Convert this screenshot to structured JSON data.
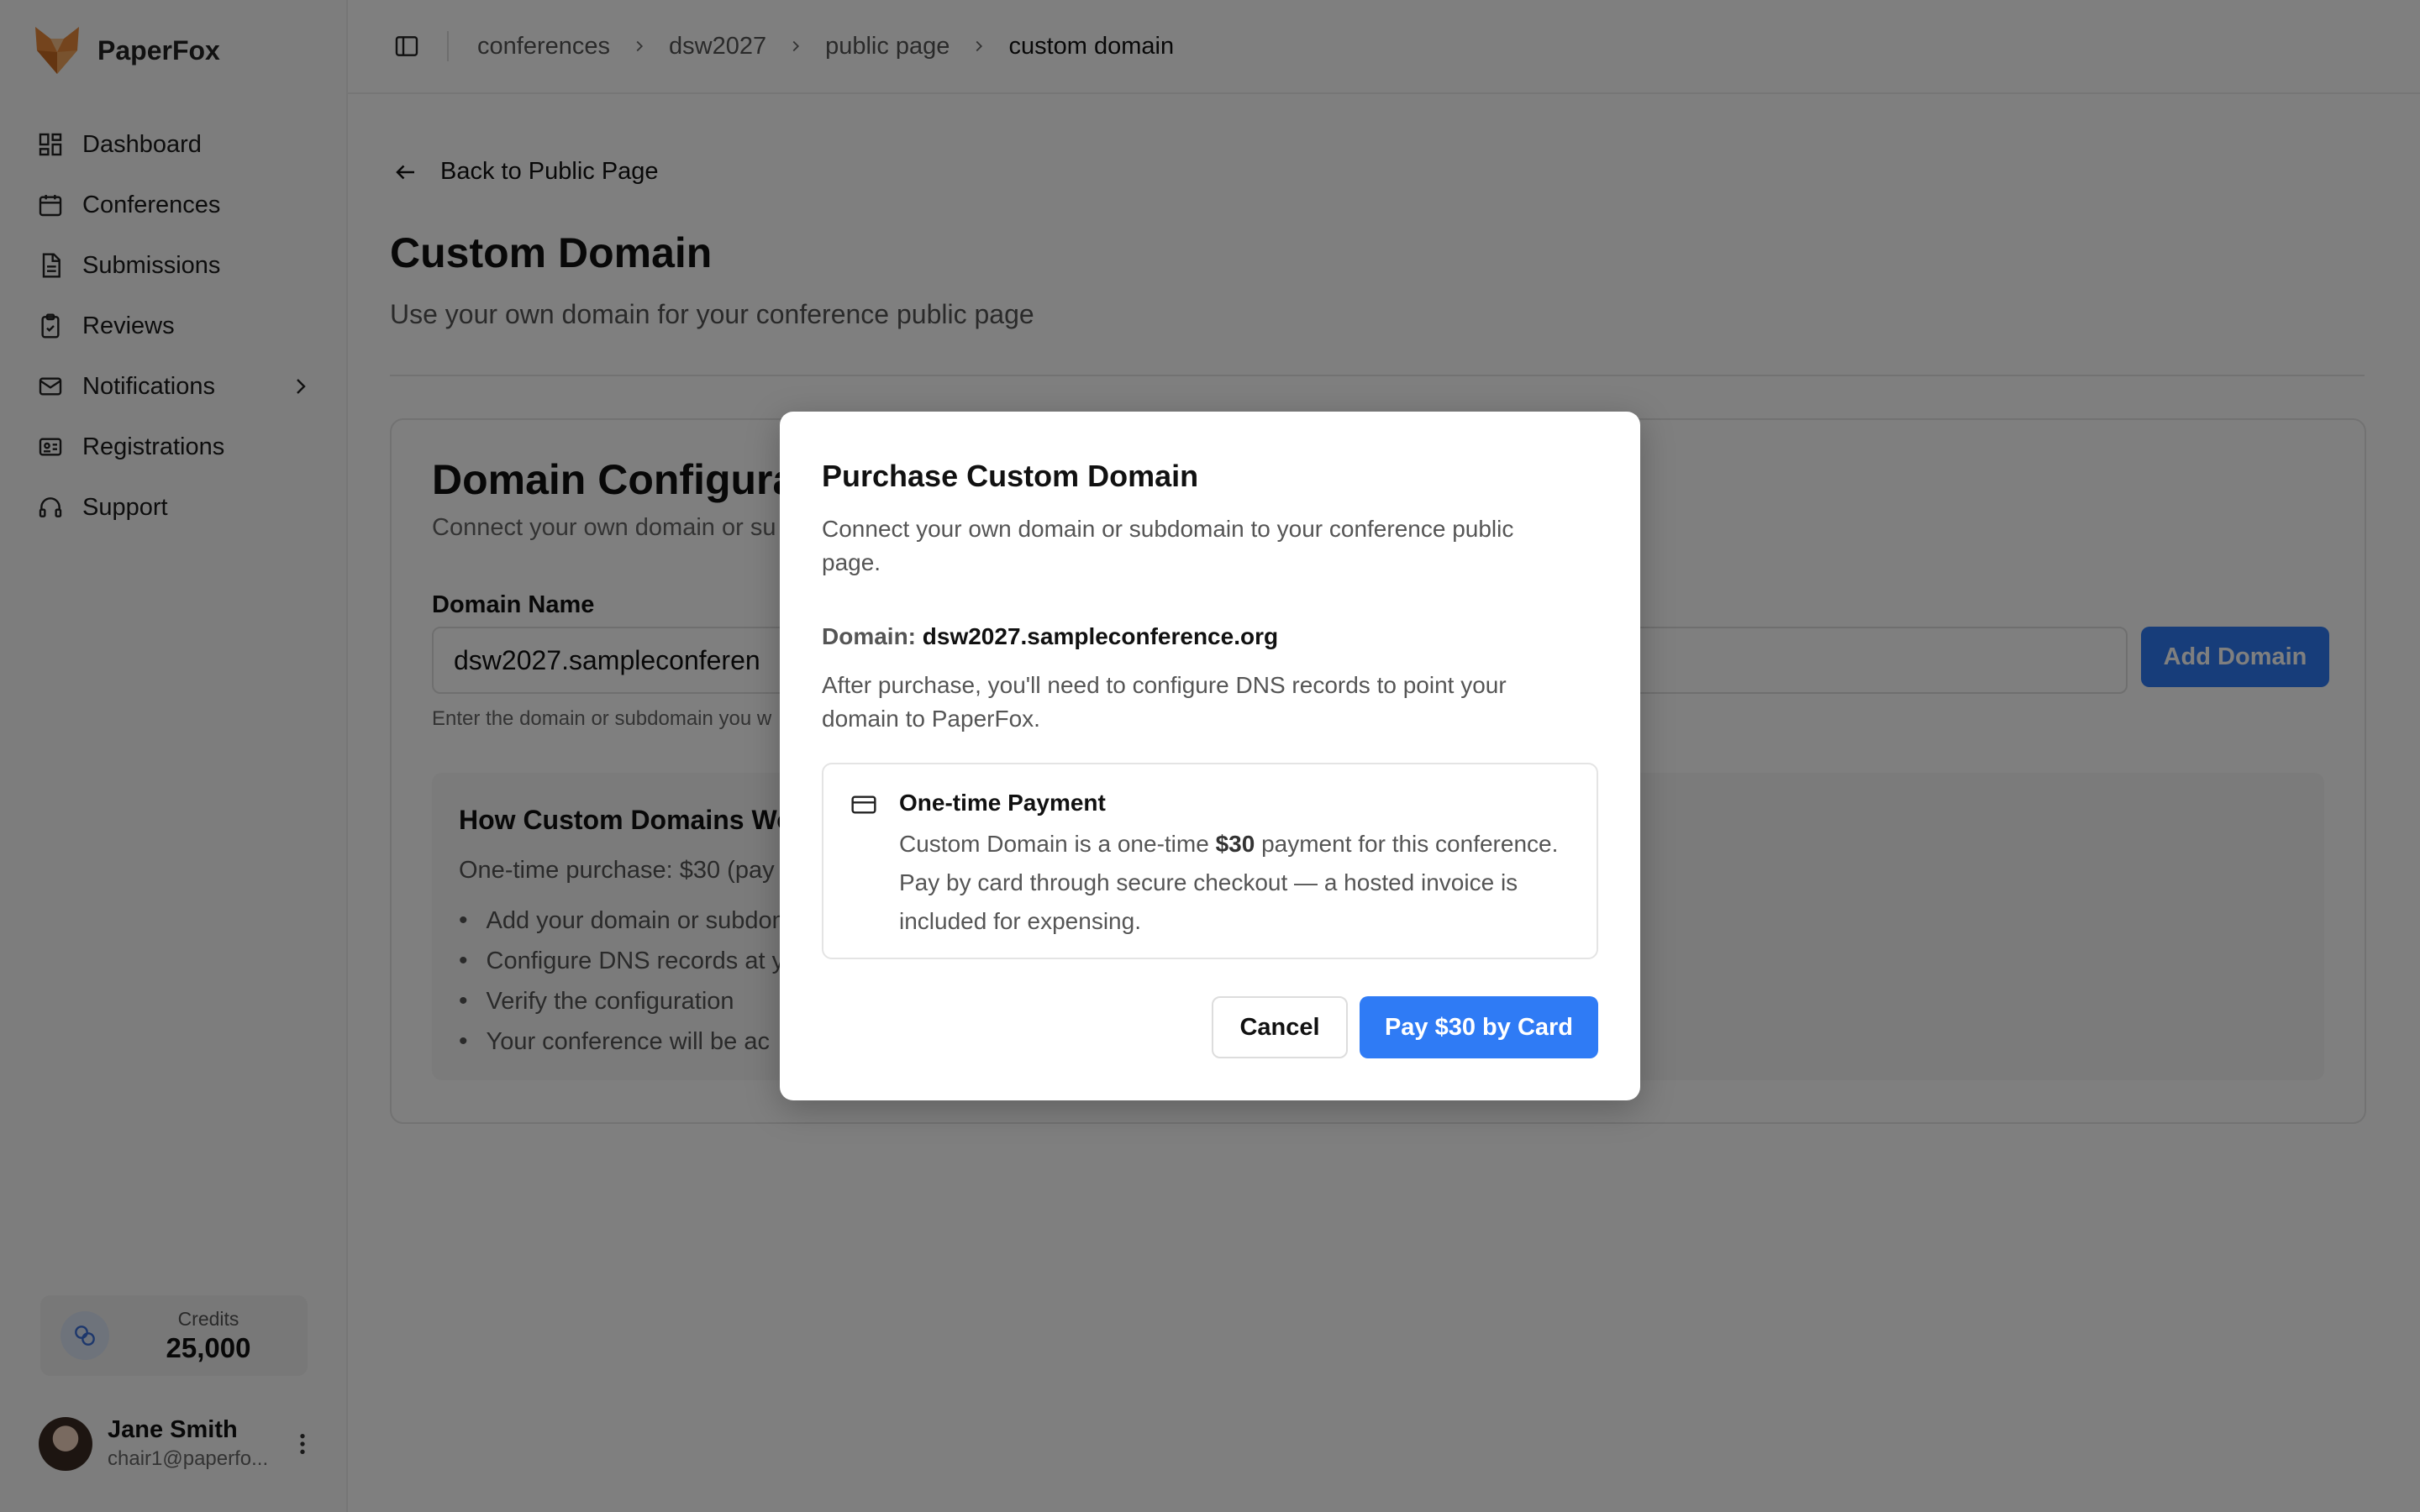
{
  "sidebar": {
    "brand": "PaperFox",
    "items": [
      {
        "label": "Dashboard",
        "icon": "dashboard-icon"
      },
      {
        "label": "Conferences",
        "icon": "calendar-icon"
      },
      {
        "label": "Submissions",
        "icon": "document-icon"
      },
      {
        "label": "Reviews",
        "icon": "clipboard-check-icon"
      },
      {
        "label": "Notifications",
        "icon": "mail-icon"
      },
      {
        "label": "Registrations",
        "icon": "id-card-icon"
      },
      {
        "label": "Support",
        "icon": "headset-icon"
      }
    ],
    "credits": {
      "label": "Credits",
      "value": "25,000"
    },
    "user": {
      "name": "Jane Smith",
      "email": "chair1@paperfo..."
    }
  },
  "breadcrumb": [
    "conferences",
    "dsw2027",
    "public page",
    "custom domain"
  ],
  "page": {
    "back_label": "Back to Public Page",
    "title": "Custom Domain",
    "subtitle": "Use your own domain for your conference public page"
  },
  "card": {
    "title": "Domain Configurat",
    "subtitle": "Connect your own domain or su",
    "field_label": "Domain Name",
    "field_value": "dsw2027.sampleconferen",
    "add_button": "Add Domain",
    "field_help": "Enter the domain or subdomain you w",
    "how": {
      "title": "How Custom Domains Wo",
      "desc": "One-time purchase: $30 (pay",
      "steps": [
        "Add your domain or subdom",
        "Configure DNS records at y",
        "Verify the configuration",
        "Your conference will be ac"
      ]
    }
  },
  "modal": {
    "title": "Purchase Custom Domain",
    "subtitle": "Connect your own domain or subdomain to your conference public page.",
    "domain_label": "Domain:",
    "domain_value": "dsw2027.sampleconference.org",
    "after": "After purchase, you'll need to configure DNS records to point your domain to PaperFox.",
    "payment": {
      "title": "One-time Payment",
      "text_pre": "Custom Domain is a one-time ",
      "price": "$30",
      "text_post": " payment for this conference. Pay by card through secure checkout — a hosted invoice is included for expensing."
    },
    "cancel": "Cancel",
    "pay": "Pay $30 by Card"
  },
  "colors": {
    "accent": "#2f7bf5",
    "overlay": "rgba(0,0,0,0.5)"
  }
}
